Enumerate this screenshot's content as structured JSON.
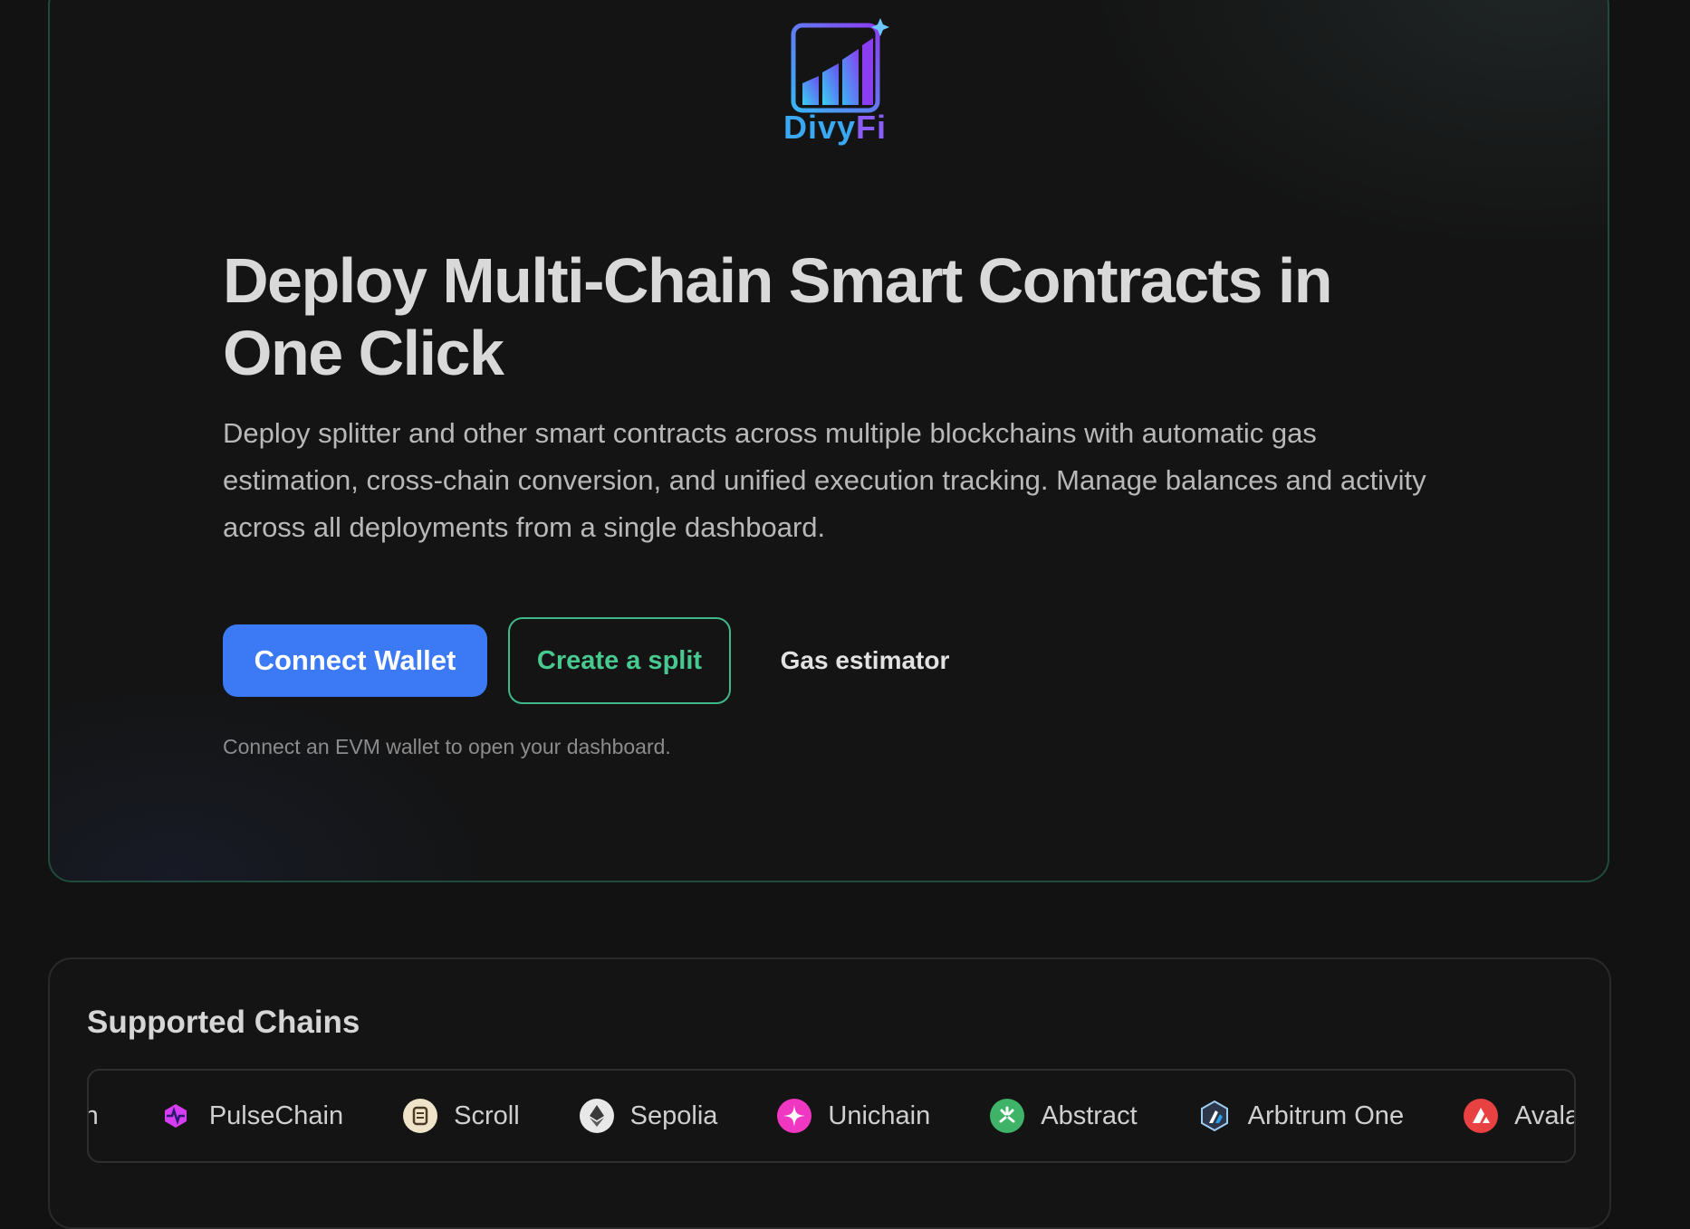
{
  "brand": {
    "name_part1": "Divy",
    "name_part2": "Fi",
    "logo_icon": "bar-chart-sparkle-icon"
  },
  "hero": {
    "title": "Deploy Multi-Chain Smart Contracts in One Click",
    "description": "Deploy splitter and other smart contracts across multiple blockchains with automatic gas estimation, cross-chain conversion, and unified execution tracking. Manage balances and activity across all deployments from a single dashboard.",
    "buttons": {
      "connect_wallet": "Connect Wallet",
      "create_split": "Create a split",
      "gas_estimator": "Gas estimator"
    },
    "hint": "Connect an EVM wallet to open your dashboard."
  },
  "chains": {
    "title": "Supported Chains",
    "items": [
      {
        "label": "Polygon",
        "icon": "polygon-icon",
        "color": "#7b3fe4"
      },
      {
        "label": "PulseChain",
        "icon": "pulsechain-icon",
        "color": "#d63cf0"
      },
      {
        "label": "Scroll",
        "icon": "scroll-icon",
        "color": "#efe3c9"
      },
      {
        "label": "Sepolia",
        "icon": "ethereum-icon",
        "color": "#e8e8e8"
      },
      {
        "label": "Unichain",
        "icon": "unichain-icon",
        "color": "#f037c2"
      },
      {
        "label": "Abstract",
        "icon": "abstract-icon",
        "color": "#3fb468"
      },
      {
        "label": "Arbitrum One",
        "icon": "arbitrum-icon",
        "color": "#2d374b"
      },
      {
        "label": "Avalanche",
        "icon": "avalanche-icon",
        "color": "#e84142"
      }
    ]
  },
  "colors": {
    "background": "#121212",
    "accent_blue": "#3b79f5",
    "accent_green": "#47c98f",
    "hero_border": "#1f4a3c"
  }
}
